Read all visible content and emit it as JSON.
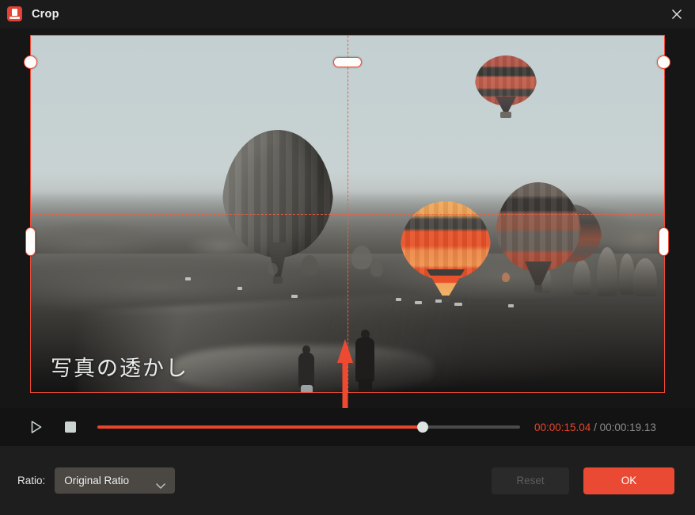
{
  "window": {
    "title": "Crop",
    "app_icon": "crop-app-icon",
    "close_icon": "close-icon",
    "accent_color": "#ea4a33",
    "titlebar_bg": "#1b1b1b",
    "panel_bg": "#1e1e1e"
  },
  "preview": {
    "watermark_text": "写真の透かし",
    "crop_overlay": {
      "border_color": "#f04b35",
      "guide_color": "#f0603f",
      "handle_fill": "#fdfdfb",
      "handles": [
        "crop-handle-top-left",
        "crop-handle-top-center",
        "crop-handle-top-right",
        "crop-handle-left-center",
        "crop-handle-right-center",
        "crop-handle-bottom-left",
        "crop-handle-bottom-center",
        "crop-handle-bottom-right"
      ]
    },
    "drag_arrow": "drag-up-arrow",
    "scene_description": "hot air balloons over valley"
  },
  "player": {
    "play_icon": "play-icon",
    "stop_icon": "stop-icon",
    "progress_percent": 77,
    "current_time": "00:00:15.04",
    "separator": "/",
    "total_time": "00:00:19.13",
    "current_time_color": "#e8452c",
    "total_time_color": "#8c8c8c"
  },
  "footer": {
    "ratio_label": "Ratio:",
    "ratio_selected": "Original Ratio",
    "ratio_chevron_icon": "chevron-down-icon",
    "reset_label": "Reset",
    "reset_disabled": true,
    "ok_label": "OK"
  }
}
